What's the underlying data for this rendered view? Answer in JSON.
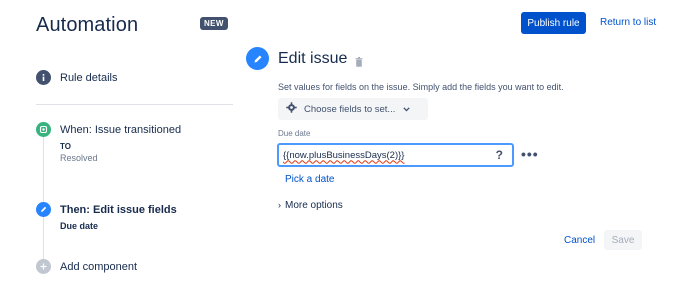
{
  "header": {
    "title": "Automation",
    "badge": "NEW",
    "publish_label": "Publish rule",
    "return_label": "Return to list"
  },
  "rule": {
    "details_label": "Rule details",
    "trigger": {
      "label": "When: Issue transitioned",
      "to_label": "TO",
      "to_value": "Resolved"
    },
    "action": {
      "label": "Then: Edit issue fields",
      "field": "Due date"
    },
    "add_label": "Add component"
  },
  "panel": {
    "title": "Edit issue",
    "description": "Set values for fields on the issue. Simply add the fields you want to edit.",
    "choose_label": "Choose fields to set...",
    "field_label": "Due date",
    "field_value": "{{now.plusBusinessDays(2)}}",
    "help_glyph": "?",
    "more_glyph": "•••",
    "pick_date_label": "Pick a date",
    "more_options_label": "More options",
    "cancel_label": "Cancel",
    "save_label": "Save"
  },
  "colors": {
    "brand_blue": "#0052cc",
    "edit_icon_blue": "#2684ff",
    "trigger_green": "#36b37e",
    "rule_details_gray": "#42526e",
    "add_gray": "#c1c7d0"
  },
  "icons": [
    "info-icon",
    "trigger-icon",
    "edit-icon",
    "add-icon",
    "trash-icon",
    "gear-icon",
    "chevron-down-icon",
    "help-icon",
    "more-icon",
    "chevron-right-icon"
  ]
}
